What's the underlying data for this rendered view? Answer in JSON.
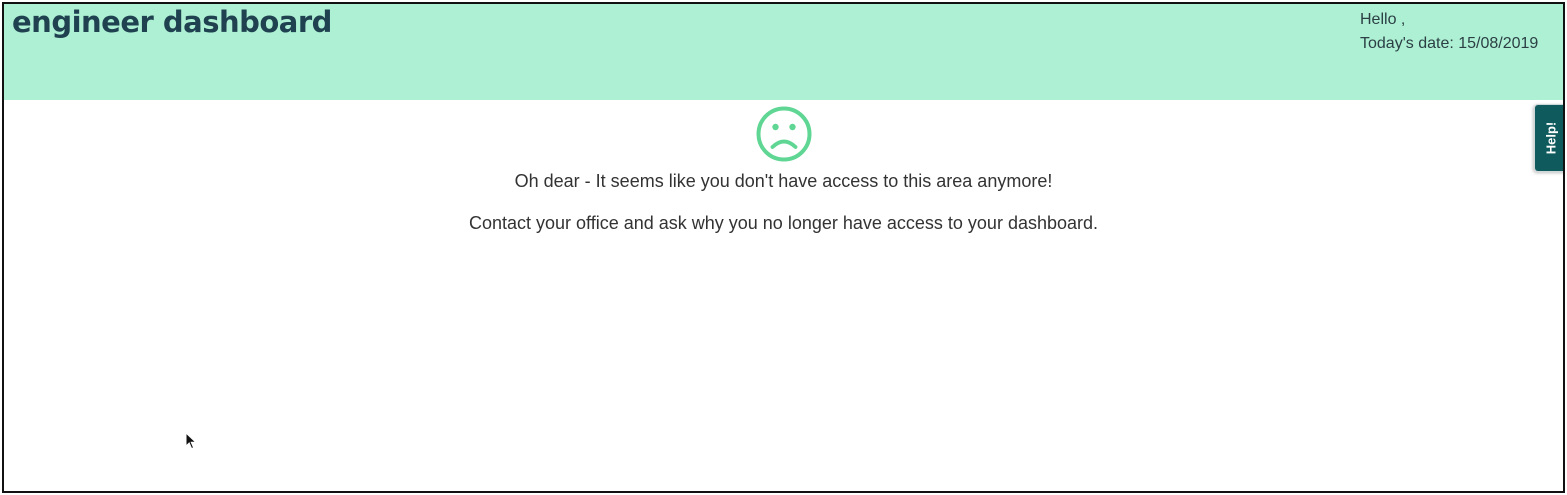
{
  "header": {
    "title": "engineer dashboard",
    "greeting": "Hello ,",
    "date_line": "Today's date: 15/08/2019",
    "background_color": "#aef0d3"
  },
  "message": {
    "icon": "sad-face-icon",
    "icon_color": "#5fd693",
    "primary": "Oh dear - It seems like you don't have access to this area anymore!",
    "secondary": "Contact your office and ask why you no longer have access to your dashboard."
  },
  "help_tab": {
    "label": "Help!",
    "color": "#0f5a5d"
  }
}
